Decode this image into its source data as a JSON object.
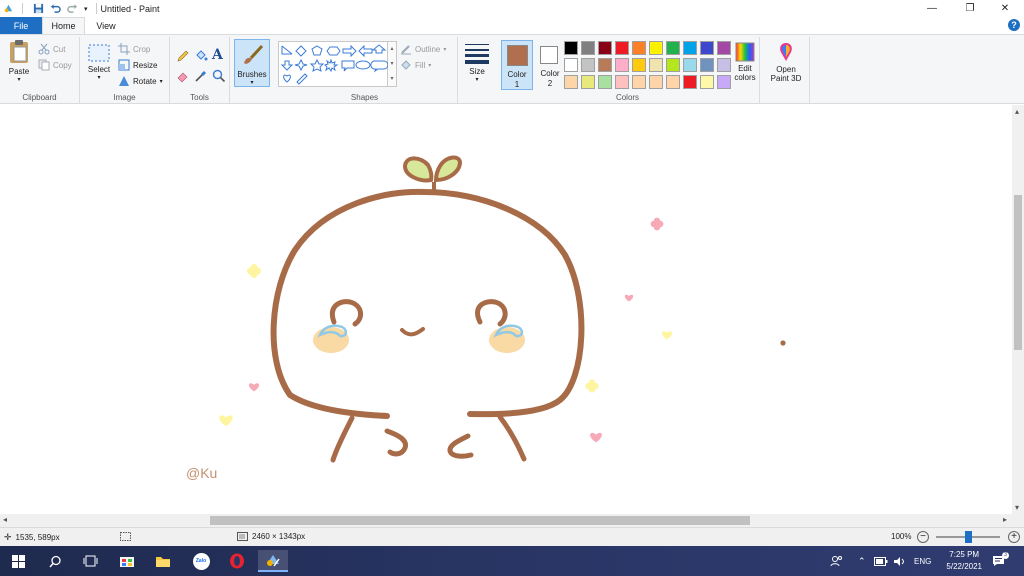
{
  "window": {
    "title": "Untitled - Paint",
    "minimize_glyph": "—",
    "restore_glyph": "❐",
    "close_glyph": "✕"
  },
  "tabs": [
    {
      "label": "File"
    },
    {
      "label": "Home"
    },
    {
      "label": "View"
    }
  ],
  "help_glyph": "?",
  "ribbon": {
    "clipboard": {
      "label": "Clipboard",
      "paste": "Paste",
      "cut": "Cut",
      "copy": "Copy"
    },
    "image": {
      "label": "Image",
      "select": "Select",
      "crop": "Crop",
      "resize": "Resize",
      "rotate": "Rotate"
    },
    "tools": {
      "label": "Tools",
      "text_glyph": "A"
    },
    "brushes": {
      "label": "Brushes"
    },
    "shapes": {
      "label": "Shapes",
      "outline": "Outline",
      "fill": "Fill"
    },
    "size": {
      "label": "Size"
    },
    "colors": {
      "label": "Colors",
      "color1_label": "Color",
      "color1_num": "1",
      "color1_value": "#b07050",
      "color2_label": "Color",
      "color2_num": "2",
      "color2_value": "#ffffff",
      "edit_colors_1": "Edit",
      "edit_colors_2": "colors",
      "palette_row1": [
        "#000000",
        "#7f7f7f",
        "#880015",
        "#ed1c24",
        "#ff7f27",
        "#fff200",
        "#22b14c",
        "#00a2e8",
        "#3f48cc",
        "#a349a4"
      ],
      "palette_row2": [
        "#ffffff",
        "#c3c3c3",
        "#b97a57",
        "#ffaec9",
        "#ffc90e",
        "#efe4b0",
        "#b5e61d",
        "#99d9ea",
        "#7092be",
        "#c8bfe7"
      ],
      "palette_row3": [
        "#fcd5a8",
        "#e7e97a",
        "#a8e0a0",
        "#ffc0c0",
        "#ffd4a8",
        "#ffd4a8",
        "#ffd4a8",
        "#ed1c24",
        "#fff8a8",
        "#c8a8f8"
      ]
    },
    "paint3d": {
      "line1": "Open",
      "line2": "Paint 3D"
    }
  },
  "canvas": {
    "signature": "@Ku",
    "stroke_color": "#a86b48",
    "leaf_color": "#d8e89a",
    "cheek_color": "#f9d9a4",
    "tear_color": "#8fc9e6",
    "heart_color": "#f6a9b6",
    "star_color": "#fff4a0"
  },
  "status": {
    "cursor": "1535, 589px",
    "size": "2460 × 1343px",
    "zoom": "100%",
    "zoom_level": 0.5
  },
  "taskbar": {
    "lang": "ENG",
    "time": "7:25 PM",
    "date": "5/22/2021",
    "zalo": "Zalo"
  }
}
